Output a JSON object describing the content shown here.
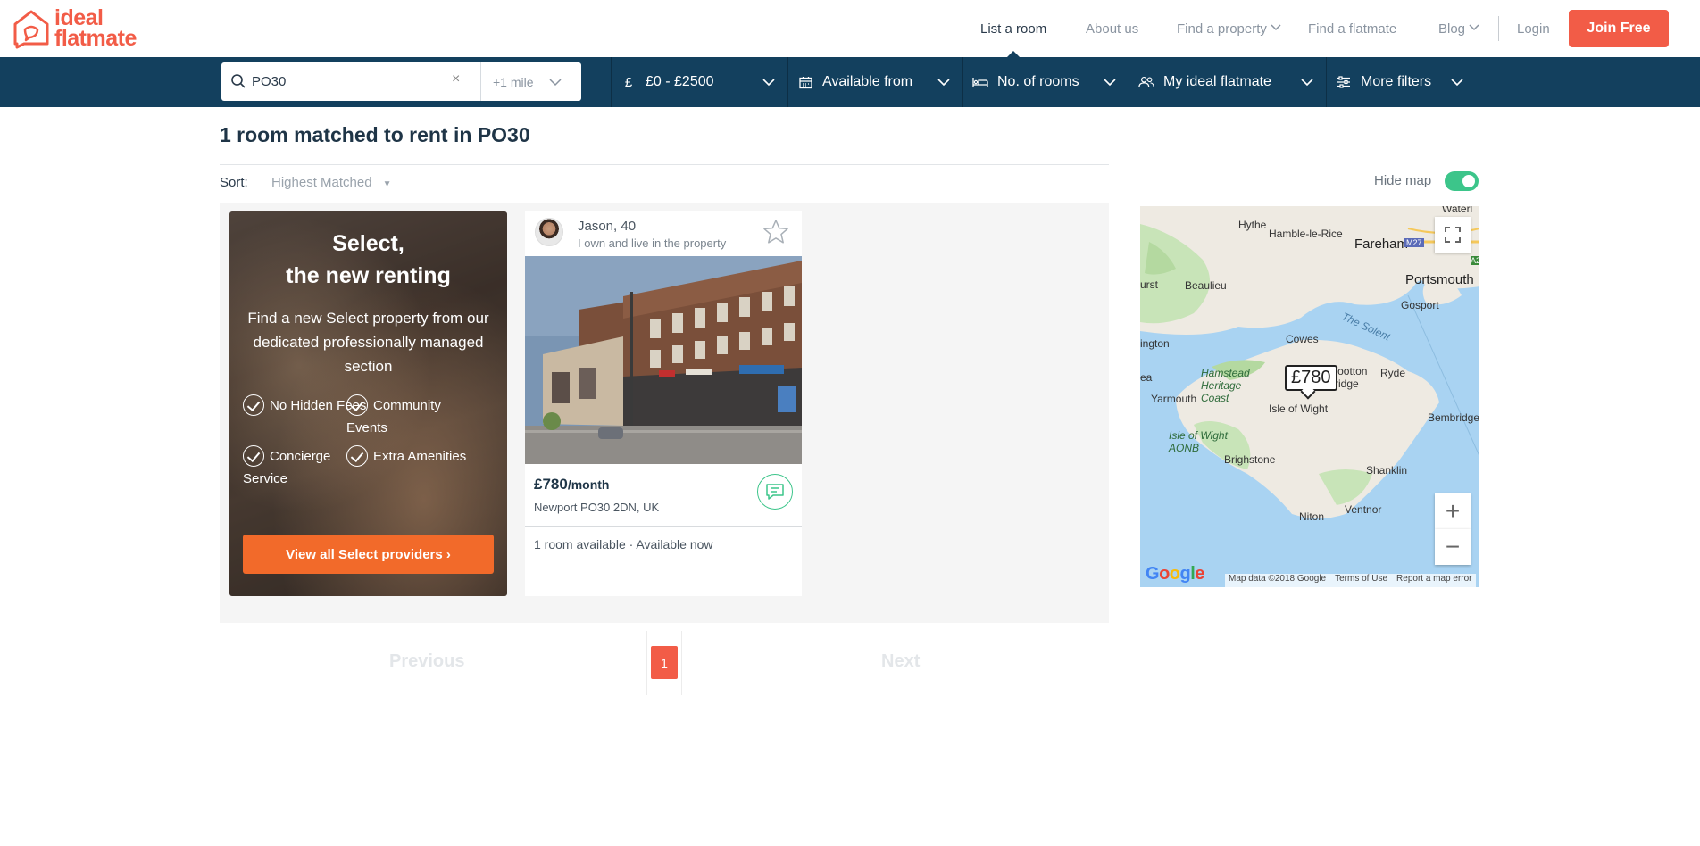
{
  "brand": {
    "line1": "ideal",
    "line2": "flatmate",
    "color": "#f25c47"
  },
  "nav": {
    "items": [
      {
        "label": "List a room",
        "active": true
      },
      {
        "label": "About us"
      },
      {
        "label": "Find a property",
        "dropdown": true
      },
      {
        "label": "Find a flatmate"
      },
      {
        "label": "Blog",
        "dropdown": true
      }
    ],
    "login": "Login",
    "join": "Join Free"
  },
  "filters": {
    "search_value": "PO30",
    "clear": "×",
    "radius": "+1 mile",
    "price": {
      "icon": "pound-icon",
      "label": "£0 - £2500"
    },
    "available": {
      "icon": "calendar-icon",
      "label": "Available from"
    },
    "rooms": {
      "icon": "bed-icon",
      "label": "No. of rooms"
    },
    "flatmate": {
      "icon": "people-icon",
      "label": "My ideal flatmate"
    },
    "more": {
      "icon": "sliders-icon",
      "label": "More filters"
    },
    "bar_color": "#13405e"
  },
  "results": {
    "heading": "1 room matched to rent in PO30",
    "sort_label": "Sort:",
    "sort_value": "Highest Matched"
  },
  "promo": {
    "title_line1": "Select,",
    "title_line2": "the new renting",
    "description": "Find a new Select property from our dedicated professionally managed section",
    "perks": [
      "No Hidden Fees",
      "Community Events",
      "Concierge Service",
      "Extra Amenities"
    ],
    "button": "View all Select providers ›",
    "button_color": "#f26a2a"
  },
  "listing": {
    "lister_name": "Jason, 40",
    "lister_role": "I own and live in the property",
    "price": "£780",
    "price_unit": "/month",
    "address": "Newport PO30 2DN, UK",
    "availability": "1 room available · Available now"
  },
  "pagination": {
    "previous": "Previous",
    "current": "1",
    "next": "Next"
  },
  "map": {
    "hide_map": "Hide map",
    "hide_map_on": true,
    "marker": "£780",
    "labels": [
      "Hythe",
      "Hamble-le-Rice",
      "Fareham",
      "M27",
      "Beaulieu",
      "Portsmouth",
      "Gosport",
      "The Solent",
      "Cowes",
      "Hamstead Heritage Coast",
      "Wootton Bridge",
      "Ryde",
      "Yarmouth",
      "Isle of Wight",
      "Bembridge",
      "Isle of Wight AONB",
      "Brighstone",
      "Shanklin",
      "Niton",
      "Ventnor",
      "urst",
      "ington",
      "ea",
      "Waterl",
      "A2"
    ],
    "footer": {
      "data": "Map data ©2018 Google",
      "terms": "Terms of Use",
      "report": "Report a map error"
    },
    "google": "Google"
  }
}
